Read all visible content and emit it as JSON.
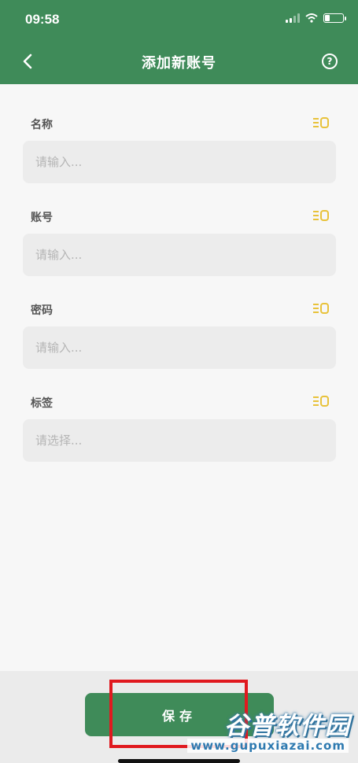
{
  "status_bar": {
    "time": "09:58"
  },
  "header": {
    "title": "添加新账号",
    "back_icon": "chevron-left-icon",
    "help_icon": "help-circle-icon",
    "help_glyph": "?"
  },
  "colors": {
    "primary": "#3f8b59",
    "icon_accent": "#e8c23a",
    "highlight": "#e0191f"
  },
  "fields": [
    {
      "label": "名称",
      "placeholder": "请输入...",
      "value": "",
      "icon": "field-options-icon"
    },
    {
      "label": "账号",
      "placeholder": "请输入...",
      "value": "",
      "icon": "field-options-icon"
    },
    {
      "label": "密码",
      "placeholder": "请输入...",
      "value": "",
      "icon": "field-options-icon"
    },
    {
      "label": "标签",
      "placeholder": "请选择...",
      "value": "",
      "icon": "field-options-icon"
    }
  ],
  "save_button": {
    "label": "保存"
  },
  "watermark": {
    "title": "谷普软件园",
    "url": "www.gupuxiazai.com"
  }
}
